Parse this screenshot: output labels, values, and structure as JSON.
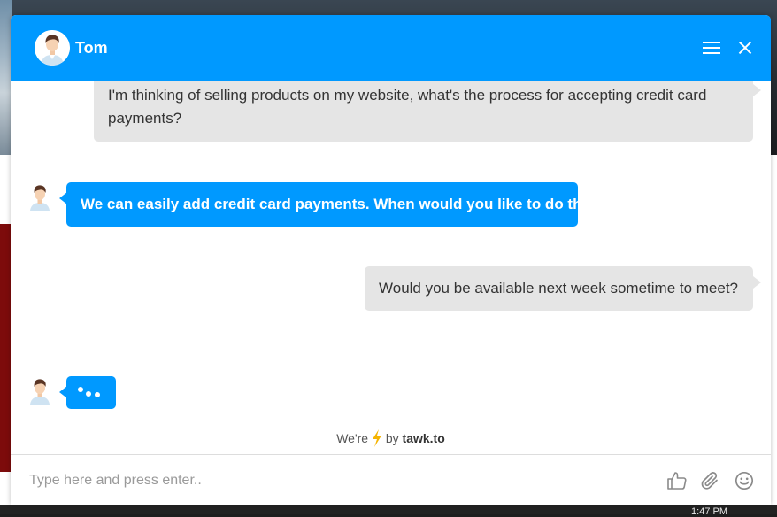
{
  "header": {
    "agent_name": "Tom"
  },
  "messages": [
    {
      "from": "visitor",
      "line1": "I'm thinking of selling products on my website, what's the process for accepting credit card",
      "line2": "payments?"
    },
    {
      "from": "agent",
      "text": "We can easily add credit card payments. When would you like to do this?"
    },
    {
      "from": "visitor",
      "text": "Would you be available next week sometime to meet?"
    },
    {
      "from": "agent",
      "typing": true
    }
  ],
  "footer": {
    "powered_prefix": "We're",
    "powered_mid": "by",
    "brand": "tawk.to"
  },
  "composer": {
    "placeholder": "Type here and press enter.."
  },
  "icons": {
    "header_menu": "hamburger-icon",
    "header_close": "close-icon",
    "composer": [
      "thumbs-up-icon",
      "paperclip-icon",
      "smiley-icon"
    ],
    "powered": "lightning-bolt-icon"
  },
  "colors": {
    "brand_blue": "#0099ff",
    "visitor_bubble": "#e5e5e5",
    "bolt": "#f5b400"
  },
  "background": {
    "clock_fragment": "1:47 PM"
  }
}
